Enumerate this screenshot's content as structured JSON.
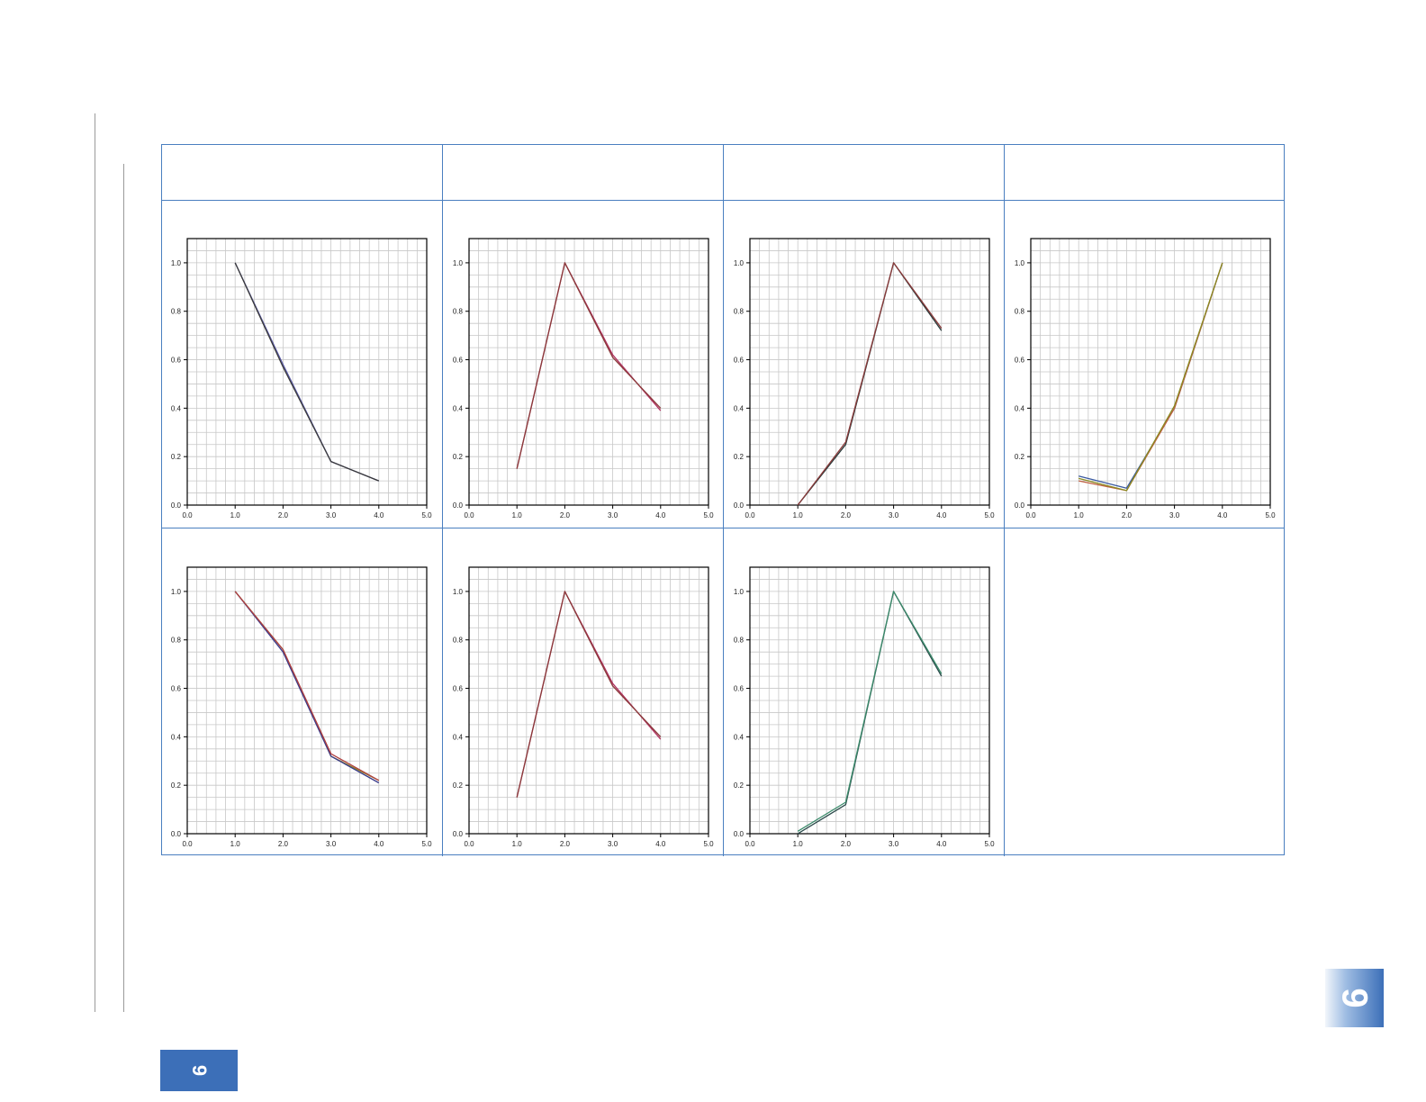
{
  "page": {
    "tab_number": "9",
    "side_tab_number": "9"
  },
  "table": {
    "header_cells": [
      "",
      "",
      "",
      ""
    ]
  },
  "axis": {
    "x_ticks": [
      "0.0",
      "1.0",
      "2.0",
      "3.0",
      "4.0",
      "5.0"
    ],
    "y_ticks": [
      "0.0",
      "0.2",
      "0.4",
      "0.6",
      "0.8",
      "1.0"
    ]
  },
  "colors": {
    "border": "#4a7fc0",
    "grid": "#c8c8c8",
    "frame": "#000000",
    "tab": "#3c6fb8"
  },
  "chart_data": [
    {
      "type": "line",
      "xlim": [
        0,
        5
      ],
      "ylim": [
        0,
        1.1
      ],
      "grid": true,
      "x": [
        1,
        2,
        3,
        4
      ],
      "series": [
        {
          "color": "#5a5aa8",
          "values": [
            1.0,
            0.58,
            0.18,
            0.1
          ]
        },
        {
          "color": "#3a3a3a",
          "values": [
            1.0,
            0.57,
            0.18,
            0.1
          ]
        }
      ]
    },
    {
      "type": "line",
      "xlim": [
        0,
        5
      ],
      "ylim": [
        0,
        1.1
      ],
      "grid": true,
      "x": [
        1,
        2,
        3,
        4
      ],
      "series": [
        {
          "color": "#b03060",
          "values": [
            0.15,
            1.0,
            0.62,
            0.39
          ]
        },
        {
          "color": "#8a3a3a",
          "values": [
            0.15,
            1.0,
            0.61,
            0.4
          ]
        }
      ]
    },
    {
      "type": "line",
      "xlim": [
        0,
        5
      ],
      "ylim": [
        0,
        1.1
      ],
      "grid": true,
      "x": [
        1,
        2,
        3,
        4
      ],
      "series": [
        {
          "color": "#2a3a3a",
          "values": [
            0.0,
            0.25,
            1.0,
            0.72
          ]
        },
        {
          "color": "#8a3a3a",
          "values": [
            0.0,
            0.26,
            1.0,
            0.73
          ]
        }
      ]
    },
    {
      "type": "line",
      "xlim": [
        0,
        5
      ],
      "ylim": [
        0,
        1.1
      ],
      "grid": true,
      "x": [
        1,
        2,
        3,
        4
      ],
      "series": [
        {
          "color": "#3a5aa0",
          "values": [
            0.12,
            0.07,
            0.4,
            1.0
          ]
        },
        {
          "color": "#c06040",
          "values": [
            0.1,
            0.06,
            0.4,
            1.0
          ]
        },
        {
          "color": "#8a8a20",
          "values": [
            0.11,
            0.06,
            0.41,
            1.0
          ]
        }
      ]
    },
    {
      "type": "line",
      "xlim": [
        0,
        5
      ],
      "ylim": [
        0,
        1.1
      ],
      "grid": true,
      "x": [
        1,
        2,
        3,
        4
      ],
      "series": [
        {
          "color": "#8a8a20",
          "values": [
            1.0,
            0.76,
            0.32,
            0.22
          ]
        },
        {
          "color": "#3a3a8a",
          "values": [
            1.0,
            0.75,
            0.32,
            0.21
          ]
        },
        {
          "color": "#b04040",
          "values": [
            1.0,
            0.76,
            0.33,
            0.22
          ]
        }
      ]
    },
    {
      "type": "line",
      "xlim": [
        0,
        5
      ],
      "ylim": [
        0,
        1.1
      ],
      "grid": true,
      "x": [
        1,
        2,
        3,
        4
      ],
      "series": [
        {
          "color": "#b03060",
          "values": [
            0.15,
            1.0,
            0.62,
            0.39
          ]
        },
        {
          "color": "#8a3a3a",
          "values": [
            0.15,
            1.0,
            0.61,
            0.4
          ]
        }
      ]
    },
    {
      "type": "line",
      "xlim": [
        0,
        5
      ],
      "ylim": [
        0,
        1.1
      ],
      "grid": true,
      "x": [
        1,
        2,
        3,
        4
      ],
      "series": [
        {
          "color": "#2a4a4a",
          "values": [
            0.0,
            0.12,
            1.0,
            0.65
          ]
        },
        {
          "color": "#3a8a6a",
          "values": [
            0.01,
            0.13,
            1.0,
            0.66
          ]
        }
      ]
    }
  ]
}
